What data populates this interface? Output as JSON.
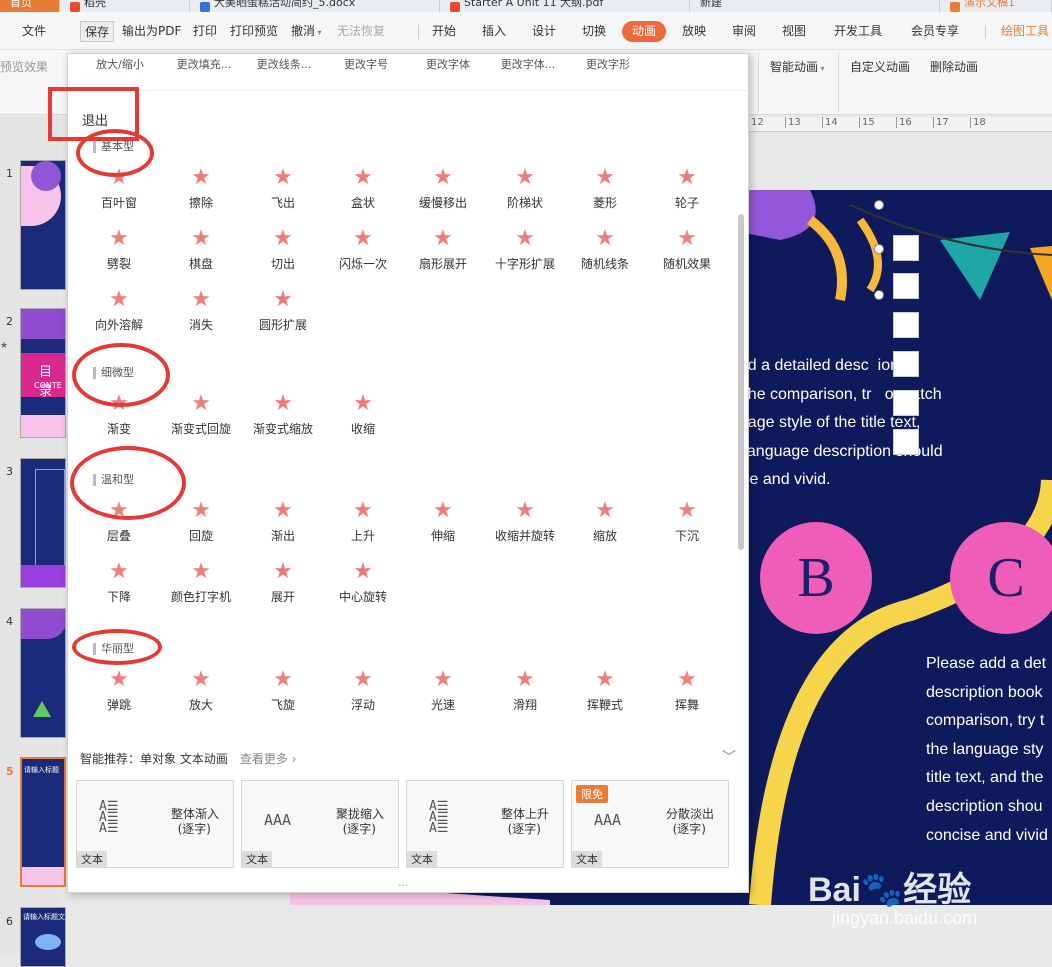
{
  "tabs": [
    "首页",
    "稻壳",
    "大美晒蛋糕活动简约_5.docx",
    "Starter A Unit 11 大纲.pdf",
    "新建",
    "演示文稿1"
  ],
  "menu": {
    "file": "文件",
    "save": "保存",
    "pdf": "输出为PDF",
    "print": "打印",
    "preview": "打印预览",
    "undo": "撤消",
    "redo": "无法恢复",
    "start": "开始",
    "insert": "插入",
    "design": "设计",
    "switch": "切换",
    "animation": "动画",
    "play": "放映",
    "review": "审阅",
    "view": "视图",
    "dev": "开发工具",
    "vip": "会员专享",
    "draw": "绘图工具"
  },
  "ribbon2": {
    "preview_effect": "预览效果",
    "smart_anim": "智能动画",
    "custom_anim": "自定义动画",
    "delete_anim": "删除动画"
  },
  "panel": {
    "top_items": [
      "放大/缩小",
      "更改填充...",
      "更改线条...",
      "更改字号",
      "更改字体",
      "更改字体...",
      "更改字形"
    ],
    "exit": "退出",
    "sections": [
      {
        "title": "基本型",
        "items": [
          "百叶窗",
          "擦除",
          "飞出",
          "盒状",
          "缓慢移出",
          "阶梯状",
          "菱形",
          "轮子",
          "劈裂",
          "棋盘",
          "切出",
          "闪烁一次",
          "扇形展开",
          "十字形扩展",
          "随机线条",
          "随机效果",
          "向外溶解",
          "消失",
          "圆形扩展"
        ]
      },
      {
        "title": "细微型",
        "items": [
          "渐变",
          "渐变式回旋",
          "渐变式缩放",
          "收缩"
        ]
      },
      {
        "title": "温和型",
        "items": [
          "层叠",
          "回旋",
          "渐出",
          "上升",
          "伸缩",
          "收缩并旋转",
          "缩放",
          "下沉",
          "下降",
          "颜色打字机",
          "展开",
          "中心旋转"
        ]
      },
      {
        "title": "华丽型",
        "items": [
          "弹跳",
          "放大",
          "飞旋",
          "浮动",
          "光速",
          "滑翔",
          "挥鞭式",
          "挥舞"
        ]
      }
    ],
    "smart_label": "智能推荐：",
    "smart_target": "单对象 文本动画",
    "see_more": "查看更多",
    "cards": [
      {
        "line1": "整体渐入",
        "line2": "(逐字)",
        "tag": "文本",
        "badge": ""
      },
      {
        "line1": "聚拢缩入",
        "line2": "(逐字)",
        "tag": "文本",
        "badge": ""
      },
      {
        "line1": "整体上升",
        "line2": "(逐字)",
        "tag": "文本",
        "badge": ""
      },
      {
        "line1": "分散淡出",
        "line2": "(逐字)",
        "tag": "文本",
        "badge": "限免"
      }
    ],
    "dots": "..."
  },
  "thumbs": {
    "numbers": [
      "1",
      "2",
      "3",
      "4",
      "5",
      "6"
    ],
    "t2_title": "目 录",
    "t2_sub": "CONTE",
    "t5_text": "请输入标题",
    "t6_text": "请输入标题文本内容"
  },
  "ruler": [
    "12",
    "13",
    "14",
    "15",
    "16",
    "17",
    "18"
  ],
  "slide": {
    "text1": "add a detailed desc  ion\nn the comparison, tr   o match\nguage style of the title text,\ne language description should\ncise and vivid.",
    "circle_b": "B",
    "circle_c": "C",
    "text2": "Please add a det\ndescription book\ncomparison, try t\nthe language sty\ntitle text, and the\ndescription shou\nconcise and vivid"
  },
  "watermark": {
    "brand": "Bai",
    "brand2": "经验",
    "url": "jingyan.baidu.com"
  },
  "colors": {
    "accent": "#ee6a3a",
    "red_mark": "#e53935",
    "slide_bg": "#0f1a5c",
    "circle": "#ef5db8",
    "star": "#f07c7c"
  }
}
